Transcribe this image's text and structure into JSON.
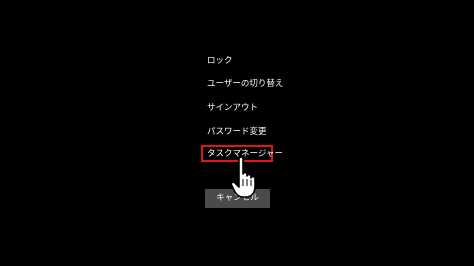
{
  "menu": {
    "items": [
      {
        "label": "ロック"
      },
      {
        "label": "ユーザーの切り替え"
      },
      {
        "label": "サインアウト"
      },
      {
        "label": "パスワード変更"
      },
      {
        "label": "タスクマネージャー"
      }
    ]
  },
  "cancel_button": {
    "label": "キャンセル"
  },
  "colors": {
    "background": "#000000",
    "text": "#ffffff",
    "highlight": "#e0141e",
    "button_bg": "#4a4a4a"
  },
  "cursor": {
    "icon": "hand-pointer-icon"
  }
}
